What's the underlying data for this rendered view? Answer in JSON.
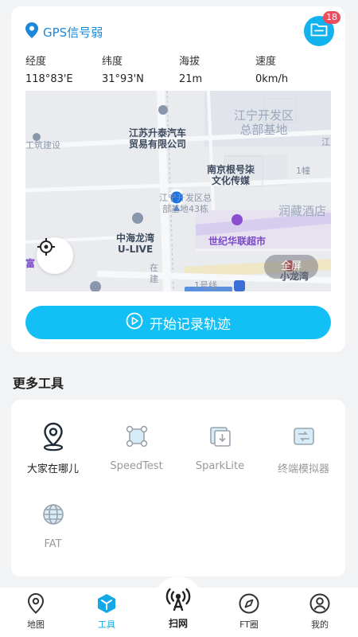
{
  "header": {
    "gps_status": "GPS信号弱",
    "badge_count": "18"
  },
  "stats": [
    {
      "label": "经度",
      "value": "118°83'E"
    },
    {
      "label": "纬度",
      "value": "31°93'N"
    },
    {
      "label": "海拔",
      "value": "21m"
    },
    {
      "label": "速度",
      "value": "0km/h"
    }
  ],
  "map": {
    "labels": {
      "jiangning_dev_hq": "江宁开发区\n总部基地",
      "jiangsu_shengtai": "江苏升泰汽车\n贸易有限公司",
      "construction": "工筑建设",
      "nanjing_media": "南京根号柒\n文化传媒",
      "building1": "1幢",
      "jiang_edge": "江",
      "runcang_hotel": "润藏酒店",
      "current_loc": "江宁开发区总\n部基地43栋",
      "shiji_supermarket": "世纪华联超市",
      "zhonghai": "中海龙湾\nU-LIVE",
      "fu_edge": "富",
      "zaijian": "在\n建",
      "line1": "1号线",
      "xiaolongwan": "小龙湾"
    },
    "fullscreen_label": "全屏"
  },
  "start_button_label": "开始记录轨迹",
  "tools": {
    "section_title": "更多工具",
    "items": [
      {
        "label": "大家在哪儿",
        "icon": "location-pin-icon"
      },
      {
        "label": "SpeedTest",
        "icon": "speed-test-icon"
      },
      {
        "label": "SparkLite",
        "icon": "spark-lite-icon"
      },
      {
        "label": "终端模拟器",
        "icon": "terminal-emulator-icon"
      },
      {
        "label": "FAT",
        "icon": "globe-icon"
      }
    ]
  },
  "tabbar": {
    "map": "地图",
    "tools": "工具",
    "scan": "扫网",
    "ft": "FT圈",
    "me": "我的"
  },
  "colors": {
    "accent": "#12c0f5",
    "gps_text": "#1a87d8",
    "badge": "#ee4d5d",
    "map_purple": "#7a48c9"
  }
}
